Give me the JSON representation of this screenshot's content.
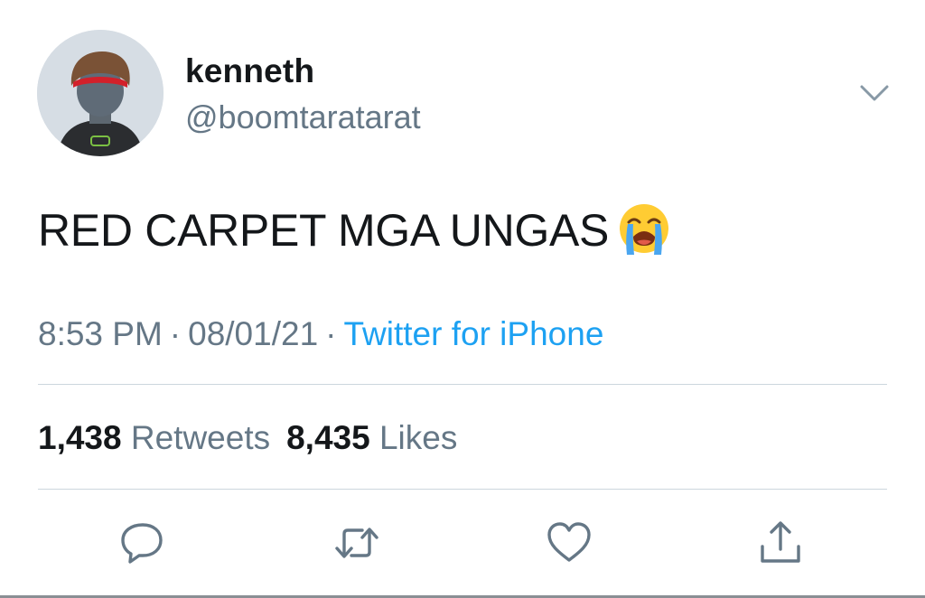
{
  "user": {
    "display_name": "kenneth",
    "handle": "@boomtaratarat"
  },
  "tweet": {
    "text": "RED CARPET MGA UNGAS",
    "emoji": "loudly-crying-face"
  },
  "meta": {
    "time": "8:53 PM",
    "separator": "·",
    "date": "08/01/21",
    "source": "Twitter for iPhone"
  },
  "stats": {
    "retweets_count": "1,438",
    "retweets_label": "Retweets",
    "likes_count": "8,435",
    "likes_label": "Likes"
  },
  "icons": {
    "menu": "chevron-down-icon",
    "reply": "reply-icon",
    "retweet": "retweet-icon",
    "like": "heart-icon",
    "share": "share-icon"
  },
  "colors": {
    "text": "#14171a",
    "secondary": "#657786",
    "link": "#1da1f2",
    "divider": "#ccd6dd"
  }
}
